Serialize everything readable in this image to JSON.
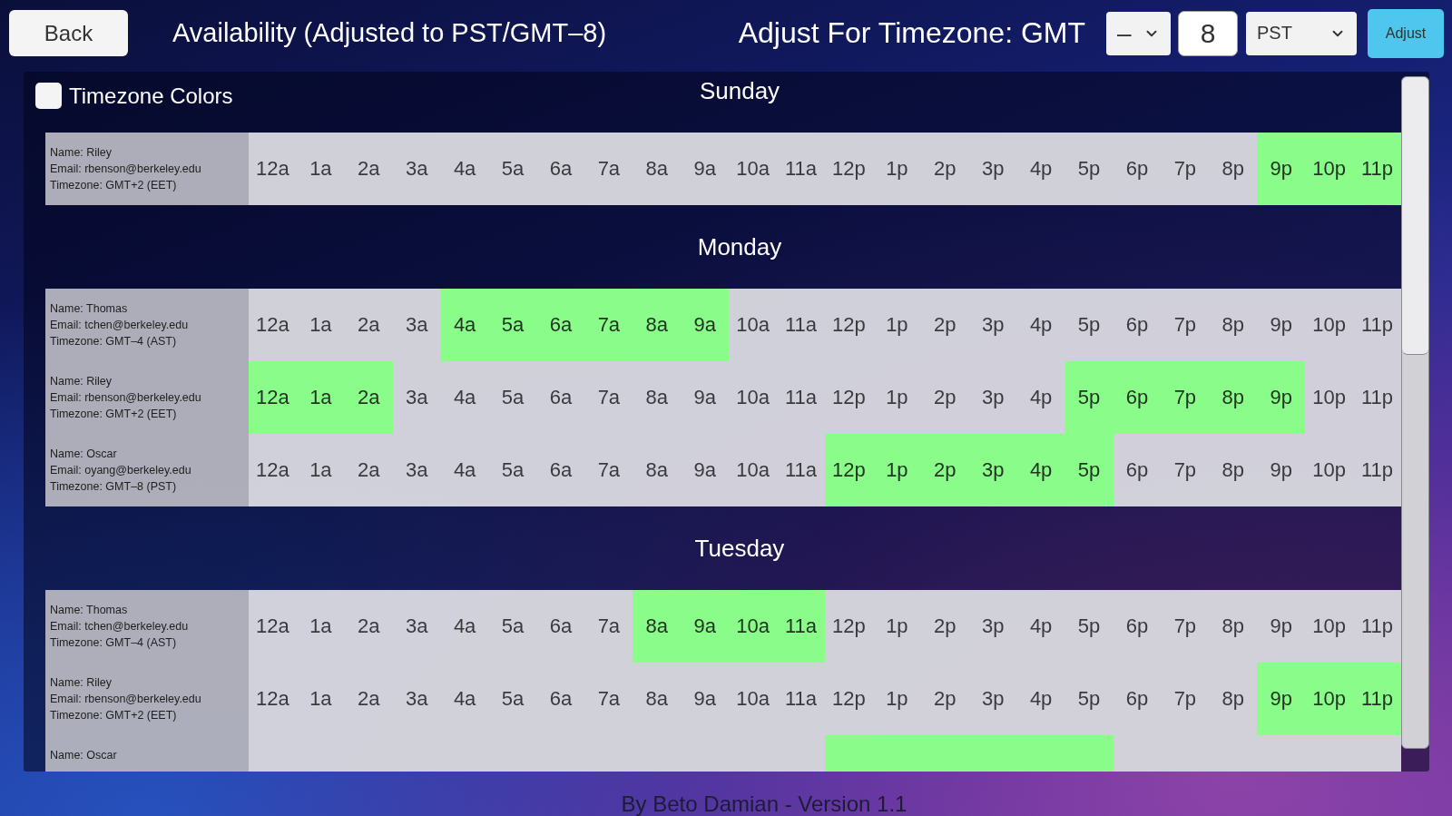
{
  "top_bar": {
    "back_button": "Back",
    "title": "Availability (Adjusted to PST/GMT–8)",
    "adjust_label": "Adjust For Timezone: GMT",
    "sign_select": {
      "value": "–"
    },
    "offset_input": {
      "value": "8"
    },
    "timezone_select": {
      "value": "PST"
    },
    "adjust_button": "Adjust"
  },
  "timezone_colors": {
    "label": "Timezone Colors",
    "checked": false
  },
  "days": [
    {
      "title": "Sunday",
      "rows": [
        {
          "details": [
            "Name: Riley",
            "Email: rbenson@berkeley.edu",
            "Timezone: GMT+2 (EET)"
          ],
          "slots": [
            {
              "label": "12a",
              "available": false
            },
            {
              "label": "1a",
              "available": false
            },
            {
              "label": "2a",
              "available": false
            },
            {
              "label": "3a",
              "available": false
            },
            {
              "label": "4a",
              "available": false
            },
            {
              "label": "5a",
              "available": false
            },
            {
              "label": "6a",
              "available": false
            },
            {
              "label": "7a",
              "available": false
            },
            {
              "label": "8a",
              "available": false
            },
            {
              "label": "9a",
              "available": false
            },
            {
              "label": "10a",
              "available": false
            },
            {
              "label": "11a",
              "available": false
            },
            {
              "label": "12p",
              "available": false
            },
            {
              "label": "1p",
              "available": false
            },
            {
              "label": "2p",
              "available": false
            },
            {
              "label": "3p",
              "available": false
            },
            {
              "label": "4p",
              "available": false
            },
            {
              "label": "5p",
              "available": false
            },
            {
              "label": "6p",
              "available": false
            },
            {
              "label": "7p",
              "available": false
            },
            {
              "label": "8p",
              "available": false
            },
            {
              "label": "9p",
              "available": true
            },
            {
              "label": "10p",
              "available": true
            },
            {
              "label": "11p",
              "available": true
            }
          ]
        }
      ]
    },
    {
      "title": "Monday",
      "rows": [
        {
          "details": [
            "Name: Thomas",
            "Email: tchen@berkeley.edu",
            "Timezone: GMT–4 (AST)"
          ],
          "slots": [
            {
              "label": "12a",
              "available": false
            },
            {
              "label": "1a",
              "available": false
            },
            {
              "label": "2a",
              "available": false
            },
            {
              "label": "3a",
              "available": false
            },
            {
              "label": "4a",
              "available": true
            },
            {
              "label": "5a",
              "available": true
            },
            {
              "label": "6a",
              "available": true
            },
            {
              "label": "7a",
              "available": true
            },
            {
              "label": "8a",
              "available": true
            },
            {
              "label": "9a",
              "available": true
            },
            {
              "label": "10a",
              "available": false
            },
            {
              "label": "11a",
              "available": false
            },
            {
              "label": "12p",
              "available": false
            },
            {
              "label": "1p",
              "available": false
            },
            {
              "label": "2p",
              "available": false
            },
            {
              "label": "3p",
              "available": false
            },
            {
              "label": "4p",
              "available": false
            },
            {
              "label": "5p",
              "available": false
            },
            {
              "label": "6p",
              "available": false
            },
            {
              "label": "7p",
              "available": false
            },
            {
              "label": "8p",
              "available": false
            },
            {
              "label": "9p",
              "available": false
            },
            {
              "label": "10p",
              "available": false
            },
            {
              "label": "11p",
              "available": false
            }
          ]
        },
        {
          "details": [
            "Name: Riley",
            "Email: rbenson@berkeley.edu",
            "Timezone: GMT+2 (EET)"
          ],
          "slots": [
            {
              "label": "12a",
              "available": true
            },
            {
              "label": "1a",
              "available": true
            },
            {
              "label": "2a",
              "available": true
            },
            {
              "label": "3a",
              "available": false
            },
            {
              "label": "4a",
              "available": false
            },
            {
              "label": "5a",
              "available": false
            },
            {
              "label": "6a",
              "available": false
            },
            {
              "label": "7a",
              "available": false
            },
            {
              "label": "8a",
              "available": false
            },
            {
              "label": "9a",
              "available": false
            },
            {
              "label": "10a",
              "available": false
            },
            {
              "label": "11a",
              "available": false
            },
            {
              "label": "12p",
              "available": false
            },
            {
              "label": "1p",
              "available": false
            },
            {
              "label": "2p",
              "available": false
            },
            {
              "label": "3p",
              "available": false
            },
            {
              "label": "4p",
              "available": false
            },
            {
              "label": "5p",
              "available": true
            },
            {
              "label": "6p",
              "available": true
            },
            {
              "label": "7p",
              "available": true
            },
            {
              "label": "8p",
              "available": true
            },
            {
              "label": "9p",
              "available": true
            },
            {
              "label": "10p",
              "available": false
            },
            {
              "label": "11p",
              "available": false
            }
          ]
        },
        {
          "details": [
            "Name: Oscar",
            "Email: oyang@berkeley.edu",
            "Timezone: GMT–8 (PST)"
          ],
          "slots": [
            {
              "label": "12a",
              "available": false
            },
            {
              "label": "1a",
              "available": false
            },
            {
              "label": "2a",
              "available": false
            },
            {
              "label": "3a",
              "available": false
            },
            {
              "label": "4a",
              "available": false
            },
            {
              "label": "5a",
              "available": false
            },
            {
              "label": "6a",
              "available": false
            },
            {
              "label": "7a",
              "available": false
            },
            {
              "label": "8a",
              "available": false
            },
            {
              "label": "9a",
              "available": false
            },
            {
              "label": "10a",
              "available": false
            },
            {
              "label": "11a",
              "available": false
            },
            {
              "label": "12p",
              "available": true
            },
            {
              "label": "1p",
              "available": true
            },
            {
              "label": "2p",
              "available": true
            },
            {
              "label": "3p",
              "available": true
            },
            {
              "label": "4p",
              "available": true
            },
            {
              "label": "5p",
              "available": true
            },
            {
              "label": "6p",
              "available": false
            },
            {
              "label": "7p",
              "available": false
            },
            {
              "label": "8p",
              "available": false
            },
            {
              "label": "9p",
              "available": false
            },
            {
              "label": "10p",
              "available": false
            },
            {
              "label": "11p",
              "available": false
            }
          ]
        }
      ]
    },
    {
      "title": "Tuesday",
      "rows": [
        {
          "details": [
            "Name: Thomas",
            "Email: tchen@berkeley.edu",
            "Timezone: GMT–4 (AST)"
          ],
          "slots": [
            {
              "label": "12a",
              "available": false
            },
            {
              "label": "1a",
              "available": false
            },
            {
              "label": "2a",
              "available": false
            },
            {
              "label": "3a",
              "available": false
            },
            {
              "label": "4a",
              "available": false
            },
            {
              "label": "5a",
              "available": false
            },
            {
              "label": "6a",
              "available": false
            },
            {
              "label": "7a",
              "available": false
            },
            {
              "label": "8a",
              "available": true
            },
            {
              "label": "9a",
              "available": true
            },
            {
              "label": "10a",
              "available": true
            },
            {
              "label": "11a",
              "available": true
            },
            {
              "label": "12p",
              "available": false
            },
            {
              "label": "1p",
              "available": false
            },
            {
              "label": "2p",
              "available": false
            },
            {
              "label": "3p",
              "available": false
            },
            {
              "label": "4p",
              "available": false
            },
            {
              "label": "5p",
              "available": false
            },
            {
              "label": "6p",
              "available": false
            },
            {
              "label": "7p",
              "available": false
            },
            {
              "label": "8p",
              "available": false
            },
            {
              "label": "9p",
              "available": false
            },
            {
              "label": "10p",
              "available": false
            },
            {
              "label": "11p",
              "available": false
            }
          ]
        },
        {
          "details": [
            "Name: Riley",
            "Email: rbenson@berkeley.edu",
            "Timezone: GMT+2 (EET)"
          ],
          "slots": [
            {
              "label": "12a",
              "available": false
            },
            {
              "label": "1a",
              "available": false
            },
            {
              "label": "2a",
              "available": false
            },
            {
              "label": "3a",
              "available": false
            },
            {
              "label": "4a",
              "available": false
            },
            {
              "label": "5a",
              "available": false
            },
            {
              "label": "6a",
              "available": false
            },
            {
              "label": "7a",
              "available": false
            },
            {
              "label": "8a",
              "available": false
            },
            {
              "label": "9a",
              "available": false
            },
            {
              "label": "10a",
              "available": false
            },
            {
              "label": "11a",
              "available": false
            },
            {
              "label": "12p",
              "available": false
            },
            {
              "label": "1p",
              "available": false
            },
            {
              "label": "2p",
              "available": false
            },
            {
              "label": "3p",
              "available": false
            },
            {
              "label": "4p",
              "available": false
            },
            {
              "label": "5p",
              "available": false
            },
            {
              "label": "6p",
              "available": false
            },
            {
              "label": "7p",
              "available": false
            },
            {
              "label": "8p",
              "available": false
            },
            {
              "label": "9p",
              "available": true
            },
            {
              "label": "10p",
              "available": true
            },
            {
              "label": "11p",
              "available": true
            }
          ]
        },
        {
          "details": [
            "Name: Oscar"
          ],
          "slots": [
            {
              "available": false
            },
            {
              "available": false
            },
            {
              "available": false
            },
            {
              "available": false
            },
            {
              "available": false
            },
            {
              "available": false
            },
            {
              "available": false
            },
            {
              "available": false
            },
            {
              "available": false
            },
            {
              "available": false
            },
            {
              "available": false
            },
            {
              "available": false
            },
            {
              "available": true
            },
            {
              "available": true
            },
            {
              "available": true
            },
            {
              "available": true
            },
            {
              "available": true
            },
            {
              "available": true
            },
            {
              "available": false
            },
            {
              "available": false
            },
            {
              "available": false
            },
            {
              "available": false
            },
            {
              "available": false
            },
            {
              "available": false
            }
          ]
        }
      ]
    }
  ],
  "footer": "By Beto Damian - Version 1.1"
}
